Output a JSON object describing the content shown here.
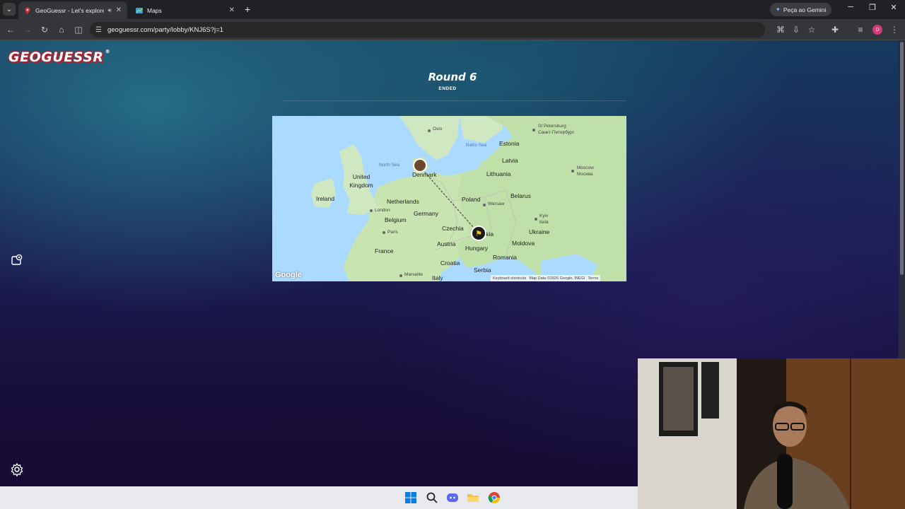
{
  "browser": {
    "tabs": [
      {
        "title": "GeoGuessr - Let's explore th",
        "active": true
      },
      {
        "title": "Maps",
        "active": false
      }
    ],
    "gemini_button": "Peça ao Gemini",
    "url": "geoguessr.com/party/lobby/KNJ6S?j=1",
    "profile_initial": "D"
  },
  "page": {
    "logo_text": "GEOGUESSR",
    "round_title": "Round 6",
    "round_status": "ENDED"
  },
  "map": {
    "labels": {
      "oslo": "Oslo",
      "st_petersburg": "St Petersburg",
      "st_petersburg_ru": "Санкт-Петербург",
      "baltic_sea": "Baltic Sea",
      "estonia": "Estonia",
      "north_sea": "North Sea",
      "latvia": "Latvia",
      "denmark": "Denmark",
      "moscow": "Moscow",
      "moscow_ru": "Москва",
      "united_kingdom": "United Kingdom",
      "lithuania": "Lithuania",
      "ireland": "Ireland",
      "netherlands": "Netherlands",
      "poland": "Poland",
      "belarus": "Belarus",
      "london": "London",
      "warsaw": "Warsaw",
      "germany": "Germany",
      "belgium": "Belgium",
      "kyiv": "Kyiv",
      "kyiv_ua": "Київ",
      "paris": "Paris",
      "czechia": "Czechia",
      "slovakia": "Slovakia",
      "ukraine": "Ukraine",
      "france": "France",
      "austria": "Austria",
      "hungary": "Hungary",
      "moldova": "Moldova",
      "romania": "Romania",
      "croatia": "Croatia",
      "marseille": "Marseille",
      "serbia": "Serbia",
      "italy": "Italy"
    },
    "google_logo": "Google",
    "attribution": {
      "shortcuts": "Keyboard shortcuts",
      "data": "Map Data ©2026 Google, INEGI",
      "terms": "Terms"
    }
  },
  "icons": {
    "settings": "gear-icon",
    "side_action": "map-pin-icon"
  }
}
